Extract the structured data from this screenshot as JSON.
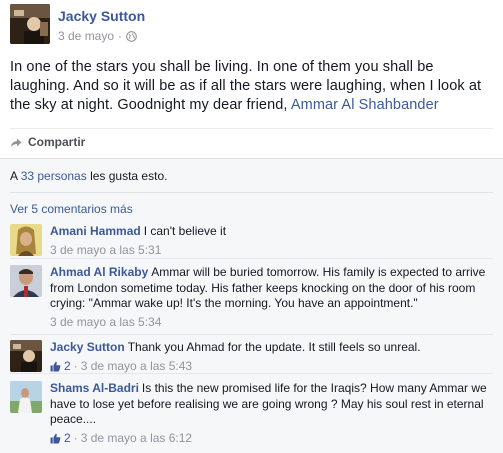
{
  "post": {
    "author": "Jacky Sutton",
    "date": "3 de mayo",
    "meta_separator": "·",
    "privacy_icon": "globe-icon",
    "text": "In one of the stars you shall be living. In one of them you shall be laughing. And so it will be as if all the stars were laughing, when I look at the sky at night. Goodnight my dear friend, ",
    "mention": "Ammar Al Shahbander"
  },
  "actions": {
    "share_label": "Compartir",
    "share_icon": "share-arrow-icon"
  },
  "likes": {
    "prefix": "A ",
    "people_link": "33 personas",
    "suffix": " les gusta esto."
  },
  "view_more_label": "Ver 5 comentarios más",
  "comments": [
    {
      "name": "Amani Hammad",
      "text": "I can't believe it",
      "time": "3 de mayo a las 5:31",
      "likes": ""
    },
    {
      "name": "Ahmad Al Rikaby",
      "text": "Ammar will be buried tomorrow. His family is expected to arrive from London sometime today. His father keeps knocking on the door of his room crying: \"Ammar wake up! It's the morning. You have an appointment.\"",
      "time": "3 de mayo a las 5:34",
      "likes": ""
    },
    {
      "name": "Jacky Sutton",
      "text": "Thank you Ahmad for the update. It still feels so unreal.",
      "time": "3 de mayo a las 5:43",
      "likes": "2"
    },
    {
      "name": "Shams Al-Badri",
      "text": "Is this the new promised life for the Iraqis? How many Ammar we have to lose yet before realising we are going wrong ? May his soul rest in eternal peace....",
      "time": "3 de mayo a las 6:12",
      "likes": "2"
    }
  ],
  "colors": {
    "link": "#3b5998",
    "meta": "#90949c",
    "ufi_background": "#f6f7f9"
  }
}
